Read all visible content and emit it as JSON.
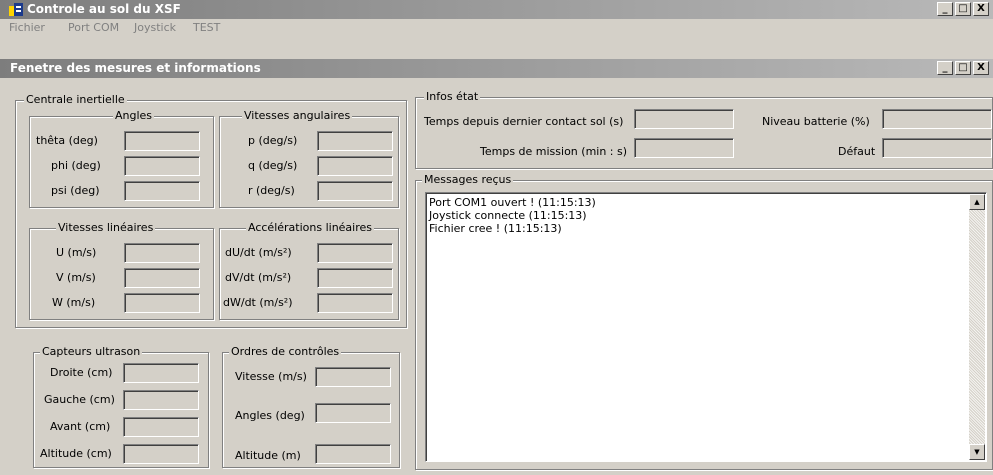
{
  "window": {
    "title": "Controle au sol du XSF",
    "min_label": "_",
    "max_label": "□",
    "close_label": "X"
  },
  "menu": [
    {
      "label": "Fichier"
    },
    {
      "label": "Port COM"
    },
    {
      "label": "Joystick"
    },
    {
      "label": "TEST"
    }
  ],
  "subwindow": {
    "title": "Fenetre des mesures et informations"
  },
  "centrale": {
    "title": "Centrale inertielle",
    "angles": {
      "title": "Angles",
      "fields": [
        "thêta (deg)",
        "phi (deg)",
        "psi (deg)"
      ]
    },
    "vit_ang": {
      "title": "Vitesses angulaires",
      "fields": [
        "p (deg/s)",
        "q (deg/s)",
        "r (deg/s)"
      ]
    },
    "vit_lin": {
      "title": "Vitesses linéaires",
      "fields": [
        "U (m/s)",
        "V (m/s)",
        "W (m/s)"
      ]
    },
    "acc_lin": {
      "title": "Accélérations linéaires",
      "fields": [
        "dU/dt (m/s²)",
        "dV/dt (m/s²)",
        "dW/dt (m/s²)"
      ]
    }
  },
  "ultrason": {
    "title": "Capteurs ultrason",
    "fields": [
      "Droite (cm)",
      "Gauche (cm)",
      "Avant (cm)",
      "Altitude (cm)"
    ]
  },
  "ordres": {
    "title": "Ordres de contrôles",
    "fields": [
      "Vitesse (m/s)",
      "Angles (deg)",
      "Altitude (m)"
    ]
  },
  "infos": {
    "title": "Infos état",
    "contact_label": "Temps depuis dernier contact sol (s)",
    "mission_label": "Temps de mission (min : s)",
    "batterie_label": "Niveau batterie (%)",
    "defaut_label": "Défaut"
  },
  "messages": {
    "title": "Messages reçus",
    "lines": [
      "Port COM1 ouvert ! (11:15:13)",
      "Joystick connecte (11:15:13)",
      "Fichier cree ! (11:15:13)"
    ]
  }
}
